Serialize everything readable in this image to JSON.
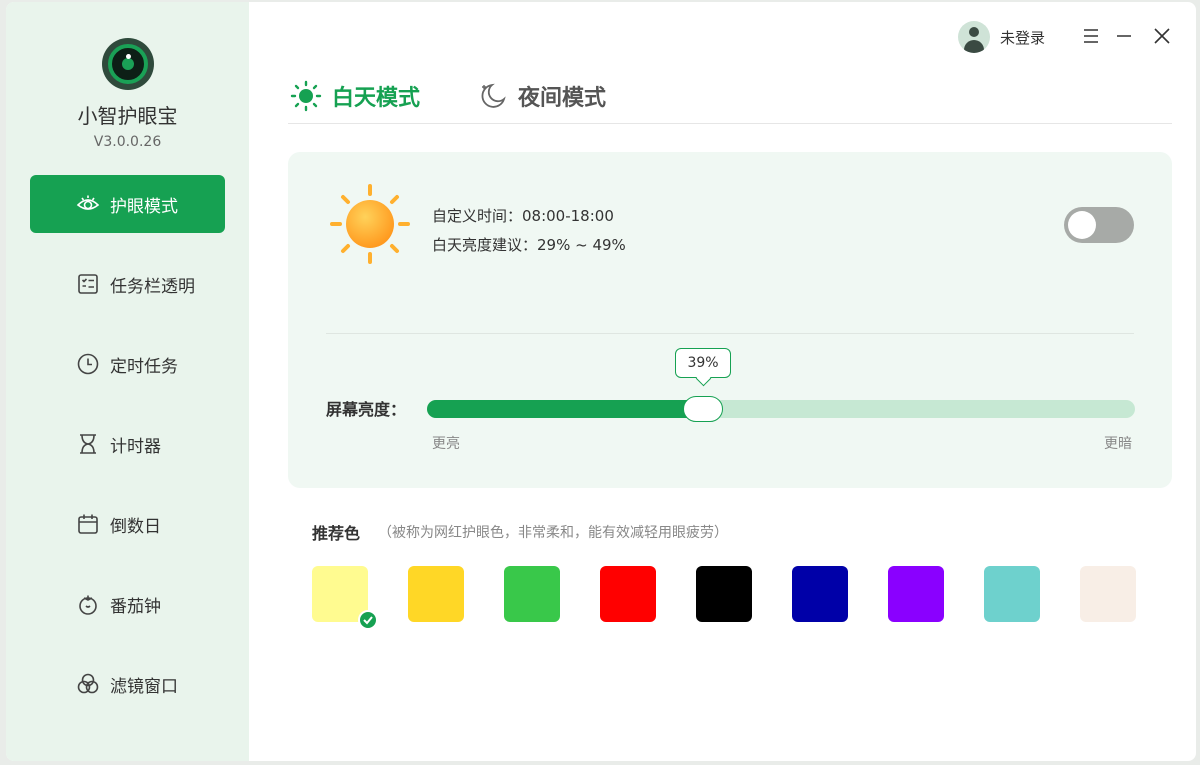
{
  "app": {
    "name": "小智护眼宝",
    "version": "V3.0.0.26"
  },
  "sidebar": {
    "items": [
      {
        "label": "护眼模式",
        "icon": "eye-icon",
        "active": true
      },
      {
        "label": "任务栏透明",
        "icon": "taskbar-icon",
        "active": false
      },
      {
        "label": "定时任务",
        "icon": "clock-icon",
        "active": false
      },
      {
        "label": "计时器",
        "icon": "hourglass-icon",
        "active": false
      },
      {
        "label": "倒数日",
        "icon": "calendar-icon",
        "active": false
      },
      {
        "label": "番茄钟",
        "icon": "tomato-icon",
        "active": false
      },
      {
        "label": "滤镜窗口",
        "icon": "filter-icon",
        "active": false
      }
    ]
  },
  "header": {
    "user_label": "未登录"
  },
  "tabs": {
    "day": "白天模式",
    "night": "夜间模式",
    "active": "day"
  },
  "day_card": {
    "custom_time": "自定义时间：08:00-18:00",
    "brightness_tip": "白天亮度建议：29% ~ 49%",
    "toggle_on": false,
    "brightness_label": "屏幕亮度：",
    "brightness_value": 39,
    "brightness_text": "39%",
    "left_label": "更亮",
    "right_label": "更暗"
  },
  "recommend": {
    "title": "推荐色",
    "note": "（被称为网红护眼色，非常柔和，能有效减轻用眼疲劳）",
    "colors": [
      "#FFFB90",
      "#FFD726",
      "#39C84A",
      "#FF0000",
      "#000000",
      "#0000A8",
      "#8A00FF",
      "#6ED1CD",
      "#F8EEE6"
    ],
    "selected_index": 0
  },
  "colors": {
    "accent": "#16A152",
    "sidebar_bg": "#E9F4EC",
    "card_bg": "#F0F8F3"
  }
}
